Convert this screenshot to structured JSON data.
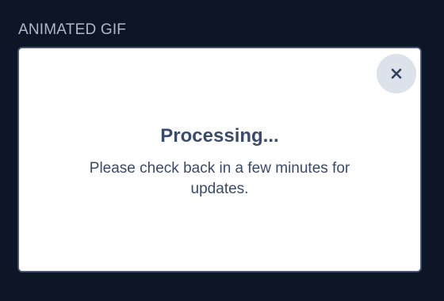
{
  "section": {
    "label": "ANIMATED GIF"
  },
  "dialog": {
    "title": "Processing...",
    "message": "Please check back in a few minutes for updates.",
    "close_icon": "close-icon"
  },
  "colors": {
    "background": "#0d1627",
    "panel": "#ffffff",
    "text": "#3a4a6b",
    "label": "#aeb7c6",
    "close_button_bg": "#dde1e9"
  }
}
